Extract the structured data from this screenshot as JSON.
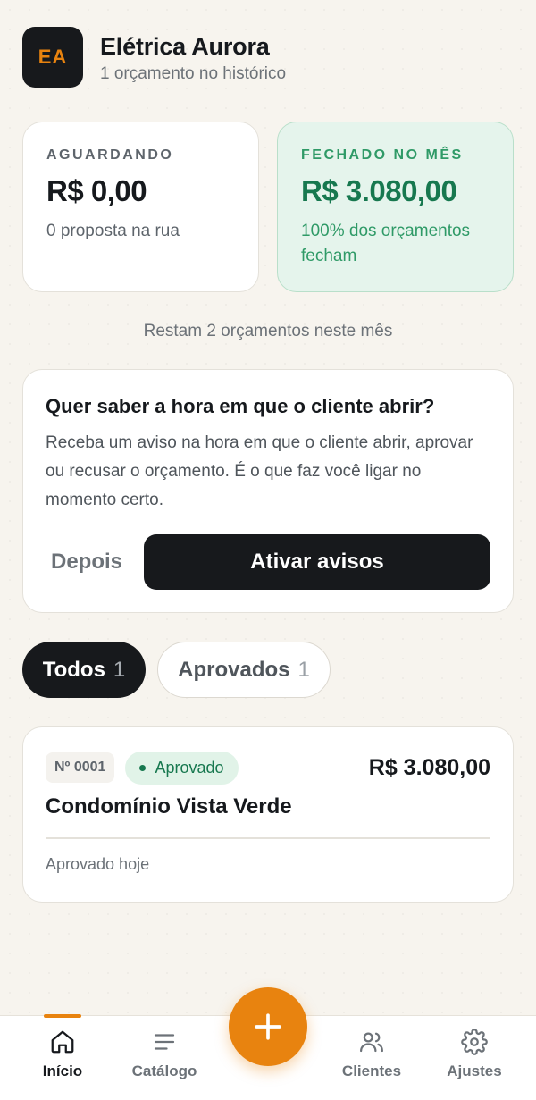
{
  "header": {
    "avatar_initials": "EA",
    "company_name": "Elétrica Aurora",
    "history_text": "1 orçamento no histórico"
  },
  "stats": {
    "waiting": {
      "label": "AGUARDANDO",
      "value": "R$ 0,00",
      "sub": "0 proposta na rua"
    },
    "closed": {
      "label": "FECHADO NO MÊS",
      "value": "R$ 3.080,00",
      "sub": "100% dos orçamentos fecham"
    }
  },
  "remaining_text": "Restam 2 orçamentos neste mês",
  "notify": {
    "title": "Quer saber a hora em que o cliente abrir?",
    "body": "Receba um aviso na hora em que o cliente abrir, aprovar ou recusar o orçamento. É o que faz você ligar no momento certo.",
    "later_label": "Depois",
    "activate_label": "Ativar avisos"
  },
  "filters": [
    {
      "label": "Todos",
      "count": "1",
      "active": true
    },
    {
      "label": "Aprovados",
      "count": "1",
      "active": false
    }
  ],
  "quotes": [
    {
      "number": "Nº 0001",
      "status": "Aprovado",
      "amount": "R$ 3.080,00",
      "client": "Condomínio Vista Verde",
      "date_text": "Aprovado hoje"
    }
  ],
  "nav": {
    "items": [
      {
        "label": "Início",
        "icon": "home-icon",
        "active": true
      },
      {
        "label": "Catálogo",
        "icon": "list-icon",
        "active": false
      },
      {
        "label": "Clientes",
        "icon": "users-icon",
        "active": false
      },
      {
        "label": "Ajustes",
        "icon": "gear-icon",
        "active": false
      }
    ],
    "fab_icon": "plus-icon"
  },
  "colors": {
    "accent": "#e8830f",
    "dark": "#17191c",
    "success": "#17784f",
    "background": "#f7f4ee"
  }
}
